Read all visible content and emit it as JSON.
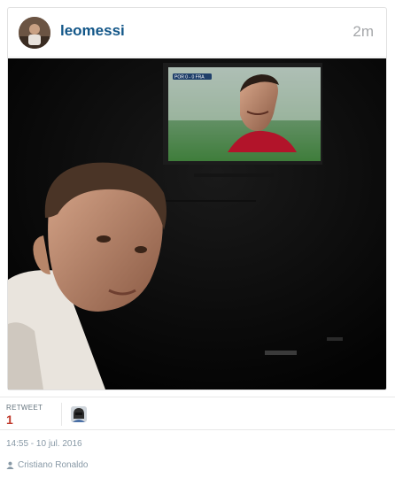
{
  "post": {
    "username": "leomessi",
    "time_ago": "2m",
    "avatar_icon": "profile-photo",
    "photo_description_icon": "photo",
    "tv_scoreboard": "POR 0 - 0 FRA"
  },
  "stats": {
    "retweet_label": "RETWEET",
    "retweet_count": "1",
    "retweeter_icon": "user-avatar-icon"
  },
  "tweet": {
    "date": "14:55 - 10 jul. 2016",
    "location": "Cristiano Ronaldo",
    "location_icon": "person-icon"
  },
  "colors": {
    "username": "#125688",
    "timestamp": "#a5a7aa",
    "retweet_count": "#c0392b",
    "meta_text": "#8899a6"
  }
}
